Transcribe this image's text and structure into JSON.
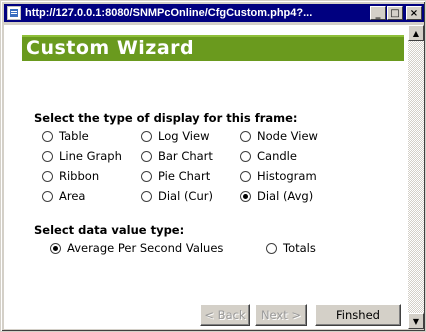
{
  "window": {
    "title": "http://127.0.0.1:8080/SNMPcOnline/CfgCustom.php4?...",
    "controls": {
      "minimize": "_",
      "maximize": "□",
      "close": "×"
    }
  },
  "header": {
    "title": "Custom Wizard"
  },
  "display_section": {
    "title": "Select the type of display for this frame:",
    "selected": "Dial (Avg)",
    "options": [
      {
        "label": "Table",
        "checked": false
      },
      {
        "label": "Log View",
        "checked": false
      },
      {
        "label": "Node View",
        "checked": false
      },
      {
        "label": "Line Graph",
        "checked": false
      },
      {
        "label": "Bar Chart",
        "checked": false
      },
      {
        "label": "Candle",
        "checked": false
      },
      {
        "label": "Ribbon",
        "checked": false
      },
      {
        "label": "Pie Chart",
        "checked": false
      },
      {
        "label": "Histogram",
        "checked": false
      },
      {
        "label": "Area",
        "checked": false
      },
      {
        "label": "Dial (Cur)",
        "checked": false
      },
      {
        "label": "Dial (Avg)",
        "checked": true
      }
    ]
  },
  "value_section": {
    "title": "Select data value type:",
    "selected": "Average Per Second Values",
    "options": [
      {
        "label": "Average Per Second Values",
        "checked": true
      },
      {
        "label": "Totals",
        "checked": false
      }
    ]
  },
  "buttons": {
    "back": "< Back",
    "next": "Next >",
    "finish": "Finshed"
  }
}
